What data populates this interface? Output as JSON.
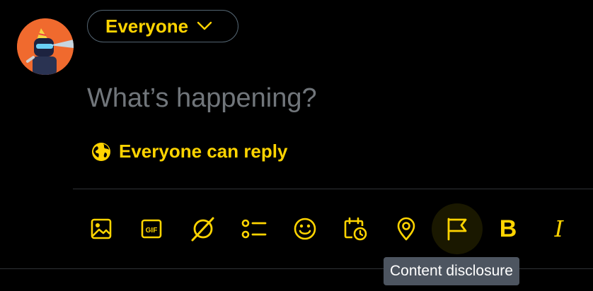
{
  "colors": {
    "accent": "#ffd400",
    "background": "#000000",
    "placeholder": "#71767b",
    "border": "#536471",
    "divider": "#2f3336",
    "tooltip_bg": "#4d5560"
  },
  "composer": {
    "audience_label": "Everyone",
    "placeholder": "What’s happening?",
    "value": "",
    "reply_setting_label": "Everyone can reply"
  },
  "toolbar": {
    "items": [
      {
        "icon": "image-icon",
        "label": "Media"
      },
      {
        "icon": "gif-icon",
        "label": "GIF"
      },
      {
        "icon": "grok-icon",
        "label": "Grok"
      },
      {
        "icon": "poll-icon",
        "label": "Poll"
      },
      {
        "icon": "emoji-icon",
        "label": "Emoji"
      },
      {
        "icon": "schedule-icon",
        "label": "Schedule"
      },
      {
        "icon": "location-icon",
        "label": "Location"
      },
      {
        "icon": "flag-icon",
        "label": "Content disclosure"
      },
      {
        "icon": "bold-icon",
        "glyph": "B"
      },
      {
        "icon": "italic-icon",
        "glyph": "I"
      }
    ],
    "hovered_item": "flag-icon"
  },
  "tooltip": {
    "text": "Content disclosure"
  }
}
